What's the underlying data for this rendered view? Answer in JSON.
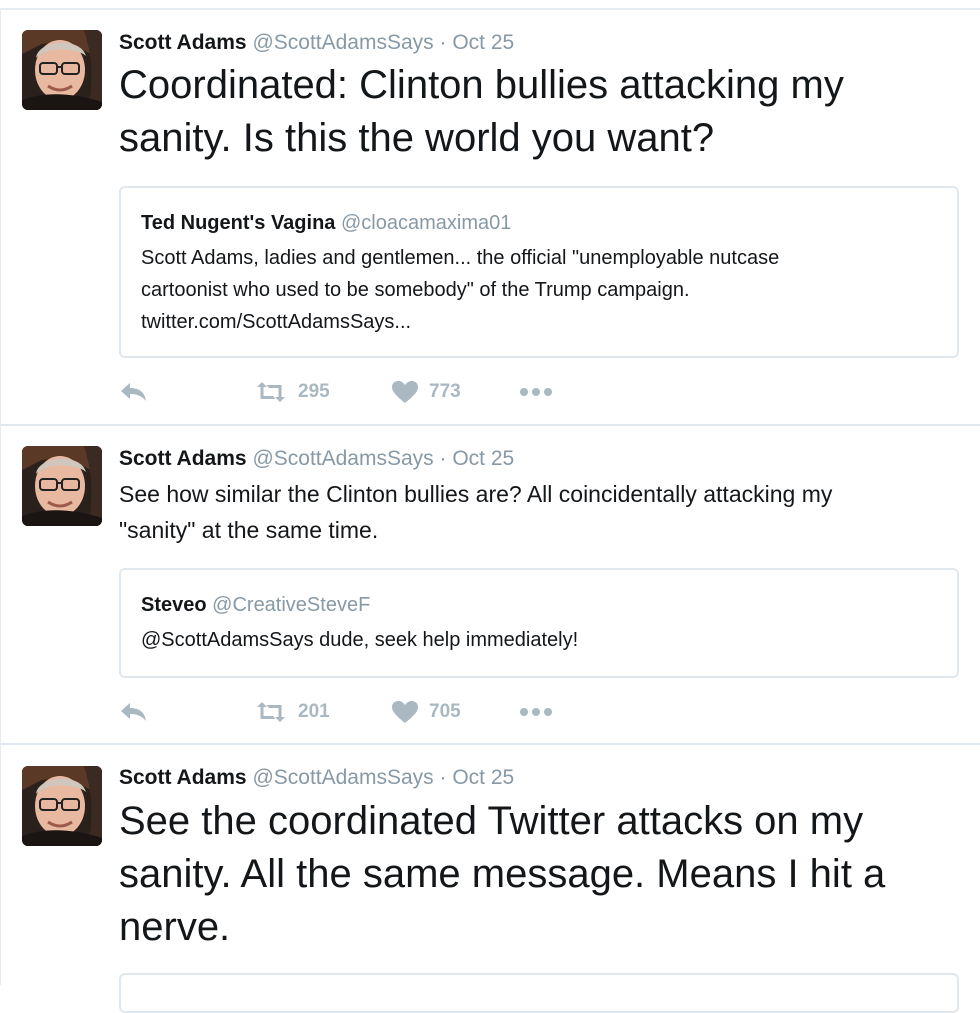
{
  "tweets": [
    {
      "author_name": "Scott Adams",
      "author_handle": "@ScottAdamsSays",
      "separator": "·",
      "date": "Oct 25",
      "text_lines": [
        "Coordinated: Clinton bullies attacking my",
        "sanity. Is this the world you want?"
      ],
      "quote": {
        "name": "Ted Nugent's Vagina",
        "handle": "@cloacamaxima01",
        "text_lines": [
          "Scott Adams, ladies and gentlemen... the official \"unemployable nutcase",
          "cartoonist who used to be somebody\" of the Trump campaign.",
          "twitter.com/ScottAdamsSays..."
        ]
      },
      "retweets": "295",
      "likes": "773"
    },
    {
      "author_name": "Scott Adams",
      "author_handle": "@ScottAdamsSays",
      "separator": "·",
      "date": "Oct 25",
      "text_lines": [
        "See how similar the Clinton bullies are? All coincidentally attacking my",
        "\"sanity\" at the same time."
      ],
      "quote": {
        "name": "Steveo",
        "handle": "@CreativeSteveF",
        "text_lines": [
          "@ScottAdamsSays dude, seek help immediately!"
        ]
      },
      "retweets": "201",
      "likes": "705"
    },
    {
      "author_name": "Scott Adams",
      "author_handle": "@ScottAdamsSays",
      "separator": "·",
      "date": "Oct 25",
      "text_lines": [
        "See the coordinated Twitter attacks on my",
        "sanity. All the same message. Means I hit a",
        "nerve."
      ]
    }
  ],
  "icons": {
    "reply": "reply-icon",
    "retweet": "retweet-icon",
    "like": "heart-icon",
    "more": "more-dots-icon"
  },
  "colors": {
    "text": "#14171a",
    "secondary": "#8899a6",
    "action_gray": "#aab8c2",
    "border": "#e1e8ed"
  }
}
